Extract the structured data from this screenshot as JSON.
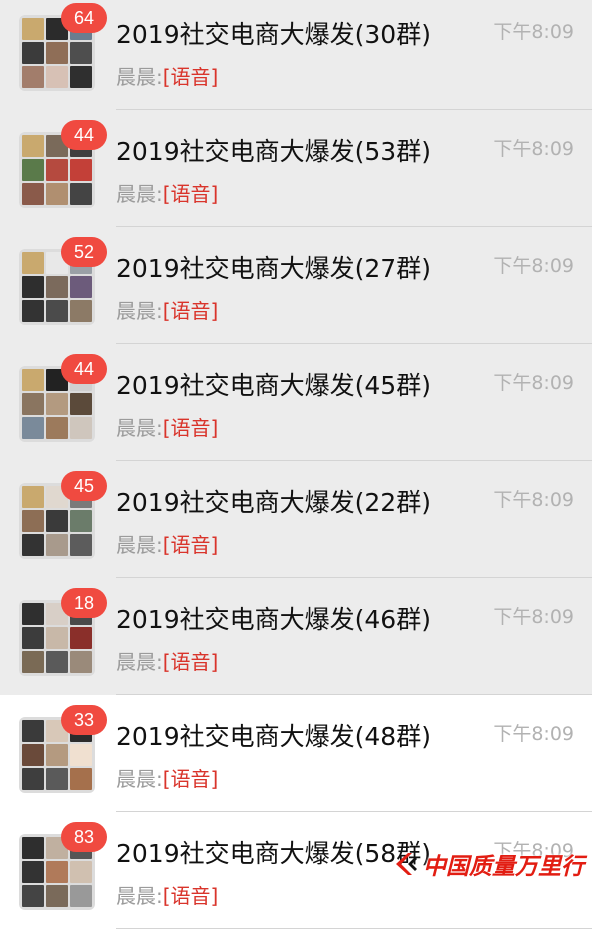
{
  "chats": [
    {
      "title": "2019社交电商大爆发(30群)",
      "time": "下午8:09",
      "sender": "晨晨:",
      "tag": "[语音]",
      "badge": "64"
    },
    {
      "title": "2019社交电商大爆发(53群)",
      "time": "下午8:09",
      "sender": "晨晨:",
      "tag": "[语音]",
      "badge": "44"
    },
    {
      "title": "2019社交电商大爆发(27群)",
      "time": "下午8:09",
      "sender": "晨晨:",
      "tag": "[语音]",
      "badge": "52"
    },
    {
      "title": "2019社交电商大爆发(45群)",
      "time": "下午8:09",
      "sender": "晨晨:",
      "tag": "[语音]",
      "badge": "44"
    },
    {
      "title": "2019社交电商大爆发(22群)",
      "time": "下午8:09",
      "sender": "晨晨:",
      "tag": "[语音]",
      "badge": "45"
    },
    {
      "title": "2019社交电商大爆发(46群)",
      "time": "下午8:09",
      "sender": "晨晨:",
      "tag": "[语音]",
      "badge": "18"
    },
    {
      "title": "2019社交电商大爆发(48群)",
      "time": "下午8:09",
      "sender": "晨晨:",
      "tag": "[语音]",
      "badge": "33"
    },
    {
      "title": "2019社交电商大爆发(58群)",
      "time": "下午8:09",
      "sender": "晨晨:",
      "tag": "[语音]",
      "badge": "83"
    }
  ],
  "watermark": {
    "text": "中国质量万里行"
  },
  "colors": {
    "badge": "#f04a40",
    "voice_tag": "#d9342b",
    "row_highlight": "#ececec",
    "watermark": "#e21d12"
  }
}
